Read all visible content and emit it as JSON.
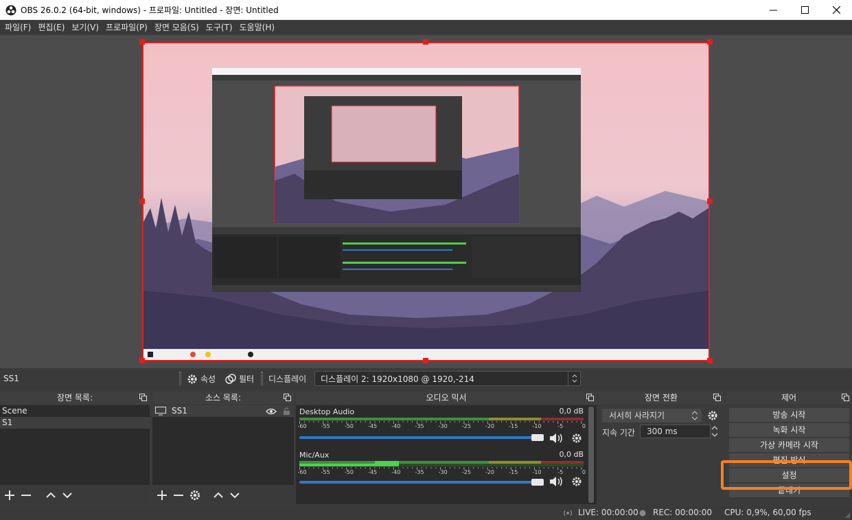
{
  "window": {
    "title": "OBS 26.0.2 (64-bit, windows) - 프로파일: Untitled - 장면: Untitled"
  },
  "menu": [
    "파일(F)",
    "편집(E)",
    "보기(V)",
    "프로파일(P)",
    "장면 모음(S)",
    "도구(T)",
    "도움말(H)"
  ],
  "scenebar": {
    "scene_name": "SS1",
    "properties_label": "속성",
    "filters_label": "필터",
    "display_label": "디스플레이",
    "display_value": "디스플레이 2: 1920x1080 @ 1920,-214"
  },
  "docks": {
    "scenes": {
      "title": "장면 목록:",
      "items": [
        "Scene",
        "S1"
      ],
      "selected": 1
    },
    "sources": {
      "title": "소스 목록:",
      "items": [
        "SS1"
      ]
    },
    "mixer": {
      "title": "오디오 믹서",
      "channels": [
        {
          "name": "Desktop Audio",
          "db": "0,0 dB",
          "level": 0.92
        },
        {
          "name": "Mic/Aux",
          "db": "0,0 dB",
          "level": 0.35
        }
      ],
      "ticks": [
        "-60",
        "-55",
        "-50",
        "-45",
        "-40",
        "-35",
        "-30",
        "-25",
        "-20",
        "-15",
        "-10",
        "-5",
        "0"
      ]
    },
    "transitions": {
      "title": "장면 전환",
      "type": "서서히 사라지기",
      "duration_label": "지속 기간",
      "duration_value": "300 ms"
    },
    "controls": {
      "title": "제어",
      "buttons": [
        "방송 시작",
        "녹화 시작",
        "가상 카메라 시작",
        "편집 방식",
        "설정",
        "끝내기"
      ]
    }
  },
  "status": {
    "live": "LIVE: 00:00:00",
    "rec": "REC: 00:00:00",
    "cpu": "CPU: 0,9%, 60,00 fps"
  },
  "colors": {
    "accent_red": "#e01f1f",
    "highlight_orange": "#ff7f1f",
    "slider_blue": "#2f79c8"
  }
}
